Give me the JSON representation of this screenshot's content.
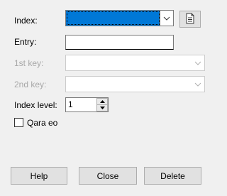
{
  "form": {
    "index_label": "Index:",
    "index_value": "",
    "entry_label": "Entry:",
    "entry_value": "",
    "first_key_label": "1st key:",
    "first_key_value": "",
    "second_key_label": "2nd key:",
    "second_key_value": "",
    "index_level_label": "Index level:",
    "index_level_value": "1",
    "checkbox_label": "Qara eo",
    "checkbox_checked": false
  },
  "buttons": {
    "help": "Help",
    "close": "Close",
    "delete": "Delete"
  },
  "icons": {
    "new_index_button": "document-icon",
    "dropdown": "chevron-down-icon",
    "spin_up": "arrow-up-icon",
    "spin_down": "arrow-down-icon"
  },
  "colors": {
    "selection": "#0078d7",
    "disabled_text": "#a8a8a8",
    "background": "#f0f0f0"
  }
}
